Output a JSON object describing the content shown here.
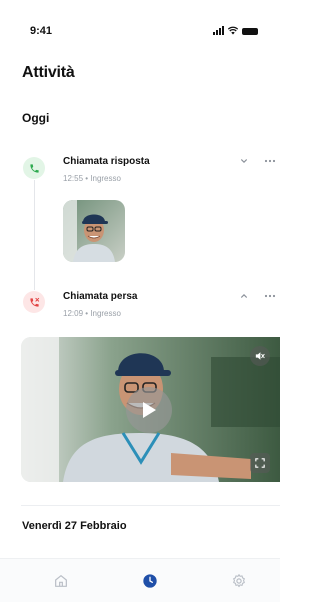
{
  "status_bar": {
    "time": "9:41"
  },
  "page": {
    "title": "Attività"
  },
  "sections": {
    "today": "Oggi",
    "previous_date": "Venerdì 27 Febbraio"
  },
  "activities": [
    {
      "title": "Chiamata risposta",
      "subtitle": "12:55 • Ingresso",
      "status_color": "#2eaa4f",
      "expanded": false
    },
    {
      "title": "Chiamata persa",
      "subtitle": "12:09 • Ingresso",
      "status_color": "#e24444",
      "expanded": true
    }
  ],
  "icons": {
    "answered": "phone-incoming-icon",
    "missed": "phone-missed-icon",
    "expand": "chevron-down-icon",
    "collapse": "chevron-up-icon",
    "more": "more-horizontal-icon",
    "mute": "volume-mute-icon",
    "play": "play-icon",
    "fullscreen": "fullscreen-icon"
  },
  "tab_bar": {
    "tabs": [
      "home",
      "activity",
      "settings"
    ],
    "active": "activity",
    "active_color": "#1f4fa8",
    "inactive_color": "#b9bec6"
  }
}
